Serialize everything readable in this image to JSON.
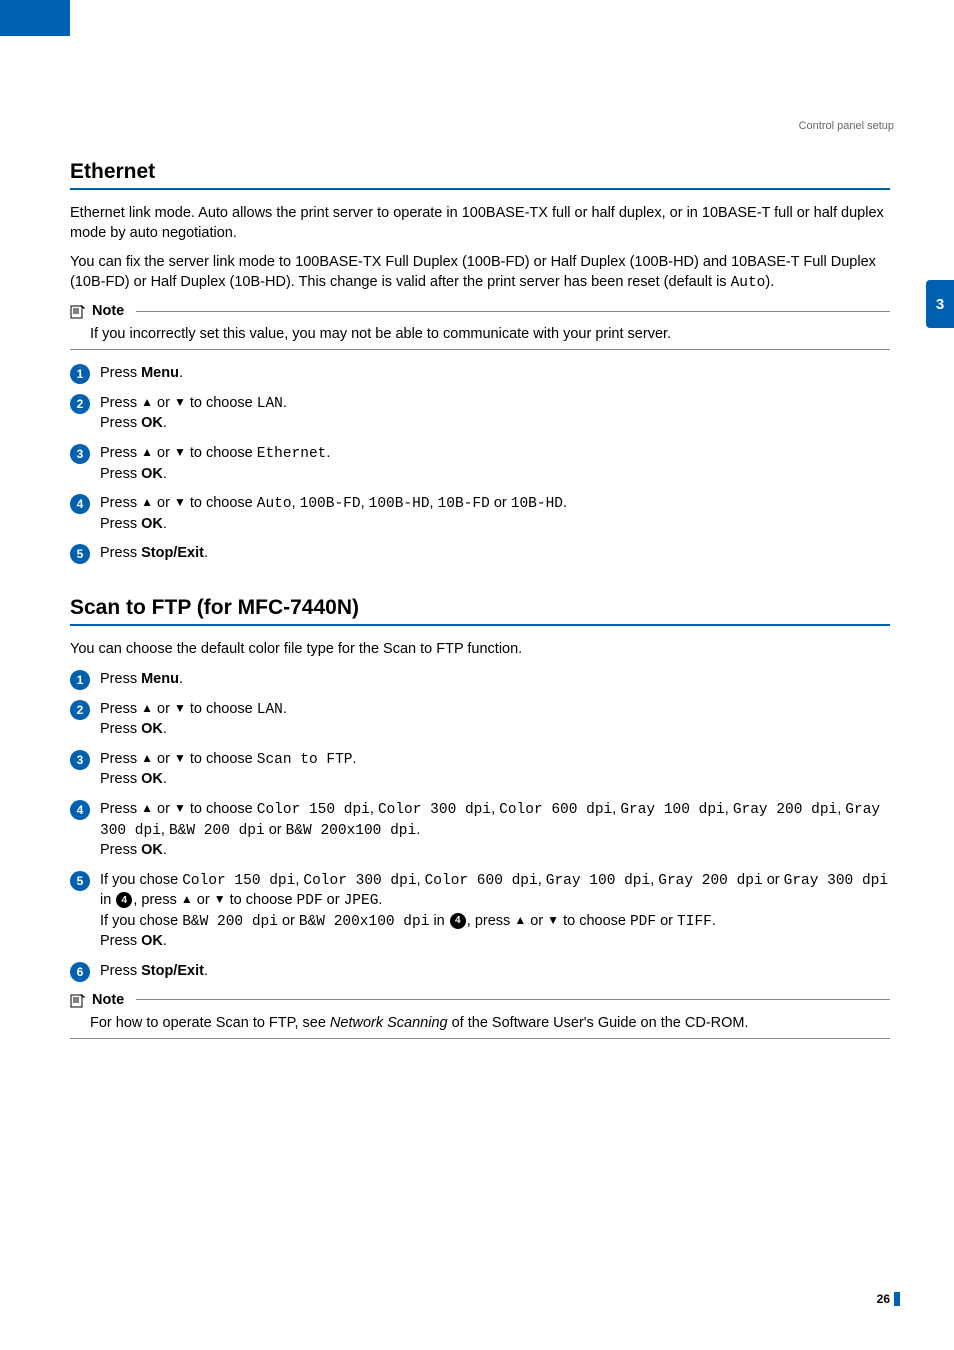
{
  "header": {
    "breadcrumb": "Control panel setup"
  },
  "sidetab": {
    "label": "3"
  },
  "section1": {
    "title": "Ethernet",
    "p1": "Ethernet link mode. Auto allows the print server to operate in 100BASE-TX full or half duplex, or in 10BASE-T full or half duplex mode by auto negotiation.",
    "p2_a": "You can fix the server link mode to 100BASE-TX Full Duplex (100B-FD) or Half Duplex (100B-HD) and 10BASE-T Full Duplex (10B-FD) or Half Duplex (10B-HD). This change is valid after the print server has been reset (default is ",
    "p2_mono": "Auto",
    "p2_b": ").",
    "note_label": "Note",
    "note_body": "If you incorrectly set this value, you may not be able to communicate with your print server.",
    "step1_a": "Press ",
    "step1_b": "Menu",
    "step1_c": ".",
    "step2_a": "Press ",
    "step2_up": "▲",
    "step2_b": " or ",
    "step2_dn": "▼",
    "step2_c": " to choose ",
    "step2_mono": "LAN",
    "step2_d": ".",
    "step2_e": "Press ",
    "step2_f": "OK",
    "step2_g": ".",
    "step3_a": "Press ",
    "step3_up": "▲",
    "step3_b": " or ",
    "step3_dn": "▼",
    "step3_c": " to choose ",
    "step3_mono": "Ethernet",
    "step3_d": ".",
    "step3_e": "Press ",
    "step3_f": "OK",
    "step3_g": ".",
    "step4_a": "Press ",
    "step4_up": "▲",
    "step4_b": " or ",
    "step4_dn": "▼",
    "step4_c": " to choose ",
    "step4_m1": "Auto",
    "step4_s1": ", ",
    "step4_m2": "100B-FD",
    "step4_s2": ", ",
    "step4_m3": "100B-HD",
    "step4_s3": ", ",
    "step4_m4": "10B-FD",
    "step4_s4": " or ",
    "step4_m5": "10B-HD",
    "step4_d": ".",
    "step4_e": "Press ",
    "step4_f": "OK",
    "step4_g": ".",
    "step5_a": "Press ",
    "step5_b": "Stop/Exit",
    "step5_c": "."
  },
  "section2": {
    "title": "Scan to FTP (for MFC-7440N)",
    "p1": "You can choose the default color file type for the Scan to FTP function.",
    "step1_a": "Press ",
    "step1_b": "Menu",
    "step1_c": ".",
    "step2_a": "Press ",
    "step2_up": "▲",
    "step2_b": " or ",
    "step2_dn": "▼",
    "step2_c": " to choose ",
    "step2_mono": "LAN",
    "step2_d": ".",
    "step2_e": "Press ",
    "step2_f": "OK",
    "step2_g": ".",
    "step3_a": "Press ",
    "step3_up": "▲",
    "step3_b": " or ",
    "step3_dn": "▼",
    "step3_c": " to choose ",
    "step3_mono": "Scan to FTP",
    "step3_d": ".",
    "step3_e": "Press ",
    "step3_f": "OK",
    "step3_g": ".",
    "step4_a": "Press ",
    "step4_up": "▲",
    "step4_b": " or ",
    "step4_dn": "▼",
    "step4_c": " to choose ",
    "step4_m1": "Color 150 dpi",
    "step4_s1": ", ",
    "step4_m2": "Color 300 dpi",
    "step4_s2": ", ",
    "step4_m3": "Color 600 dpi",
    "step4_s3": ", ",
    "step4_m4": "Gray 100 dpi",
    "step4_s4": ", ",
    "step4_m5": "Gray 200 dpi",
    "step4_s5": ", ",
    "step4_m6": "Gray 300 dpi",
    "step4_s6": ", ",
    "step4_m7": "B&W 200 dpi",
    "step4_s7": " or ",
    "step4_m8": "B&W 200x100 dpi",
    "step4_d": ".",
    "step4_e": "Press ",
    "step4_f": "OK",
    "step4_g": ".",
    "step5_a": "If you chose ",
    "step5_m1": "Color 150 dpi",
    "step5_s1": ", ",
    "step5_m2": "Color 300 dpi",
    "step5_s2": ", ",
    "step5_m3": "Color 600 dpi",
    "step5_s3": ", ",
    "step5_m4": "Gray 100 dpi",
    "step5_s4": ", ",
    "step5_m5": "Gray 200 dpi",
    "step5_s5": " or ",
    "step5_m6": "Gray 300 dpi",
    "step5_b": " in ",
    "step5_ref1": "4",
    "step5_c": ", press ",
    "step5_up": "▲",
    "step5_d": " or ",
    "step5_dn": "▼",
    "step5_e": " to choose ",
    "step5_m7": "PDF",
    "step5_f": " or ",
    "step5_m8": "JPEG",
    "step5_g": ".",
    "step5_h": "If you chose ",
    "step5_m9": "B&W 200 dpi",
    "step5_i": " or ",
    "step5_m10": "B&W 200x100 dpi",
    "step5_j": " in ",
    "step5_ref2": "4",
    "step5_k": ", press ",
    "step5_up2": "▲",
    "step5_l": " or ",
    "step5_dn2": "▼",
    "step5_m": " to choose ",
    "step5_m11": "PDF",
    "step5_n": " or ",
    "step5_m12": "TIFF",
    "step5_o": ".",
    "step5_p": "Press ",
    "step5_q": "OK",
    "step5_r": ".",
    "step6_a": "Press ",
    "step6_b": "Stop/Exit",
    "step6_c": ".",
    "note_label": "Note",
    "note_a": "For how to operate Scan to FTP, see ",
    "note_em": "Network Scanning",
    "note_b": " of the Software User's Guide on the CD-ROM."
  },
  "footer": {
    "page": "26"
  }
}
